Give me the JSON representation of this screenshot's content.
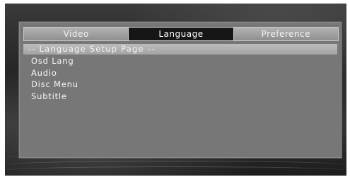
{
  "tabs": [
    {
      "label": "Video",
      "active": false
    },
    {
      "label": "Language",
      "active": true
    },
    {
      "label": "Preference",
      "active": false
    }
  ],
  "page_header": "-- Language Setup Page --",
  "menu_items": [
    "Osd Lang",
    "Audio",
    "Disc Menu",
    "Subtitle"
  ],
  "colors": {
    "panel": "#777777",
    "active_tab": "#161616",
    "tab": "#a0a0a0",
    "header_bar": "#b0b0b0",
    "text": "#f8f8f8"
  }
}
